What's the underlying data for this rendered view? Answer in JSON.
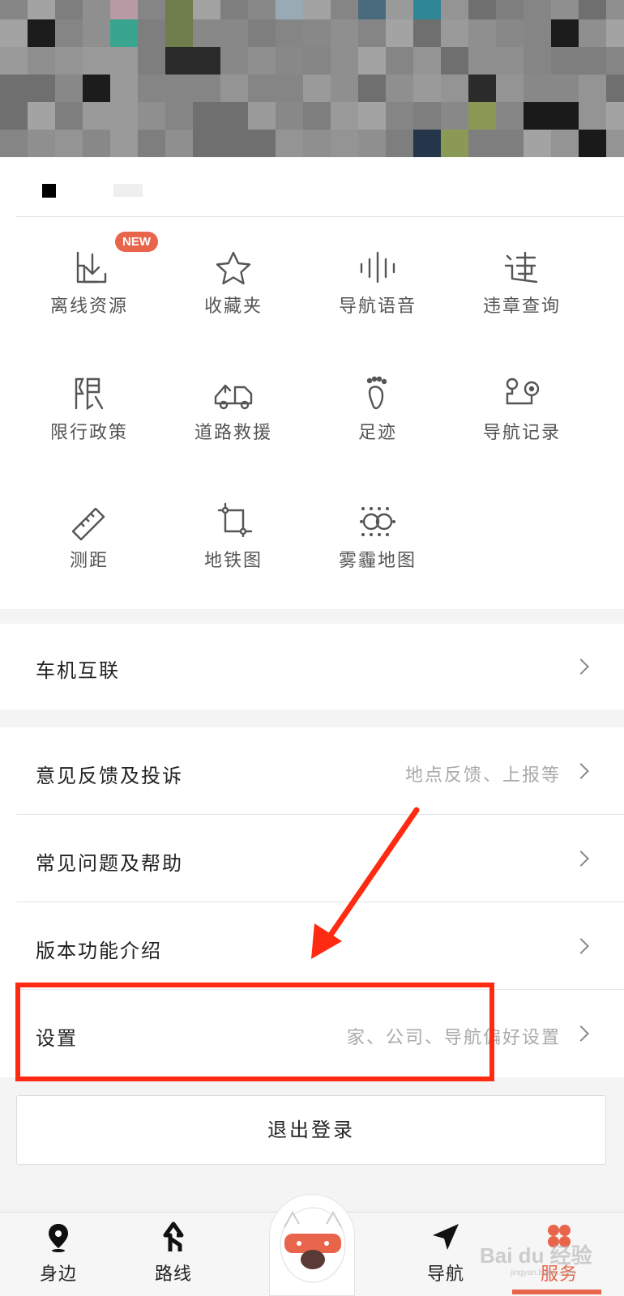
{
  "grid": {
    "badge": "NEW",
    "items": [
      {
        "label": "离线资源",
        "icon": "offline-download-icon"
      },
      {
        "label": "收藏夹",
        "icon": "star-icon"
      },
      {
        "label": "导航语音",
        "icon": "voice-wave-icon"
      },
      {
        "label": "违章查询",
        "icon": "violation-icon"
      },
      {
        "label": "限行政策",
        "icon": "restriction-icon"
      },
      {
        "label": "道路救援",
        "icon": "tow-truck-icon"
      },
      {
        "label": "足迹",
        "icon": "footprint-icon"
      },
      {
        "label": "导航记录",
        "icon": "route-record-icon"
      },
      {
        "label": "测距",
        "icon": "ruler-icon"
      },
      {
        "label": "地铁图",
        "icon": "subway-map-icon"
      },
      {
        "label": "雾霾地图",
        "icon": "haze-map-icon"
      }
    ]
  },
  "menu": {
    "car_link": {
      "title": "车机互联"
    },
    "feedback": {
      "title": "意见反馈及投诉",
      "hint": "地点反馈、上报等"
    },
    "faq": {
      "title": "常见问题及帮助"
    },
    "version": {
      "title": "版本功能介绍"
    },
    "settings": {
      "title": "设置",
      "hint": "家、公司、导航偏好设置"
    }
  },
  "logout_label": "退出登录",
  "tabbar": {
    "items": [
      {
        "label": "身边",
        "icon": "location-pin-icon"
      },
      {
        "label": "路线",
        "icon": "route-fork-icon"
      },
      {
        "label": "导航",
        "icon": "navigation-arrow-icon"
      },
      {
        "label": "服务",
        "icon": "clover-icon"
      }
    ],
    "active": "服务"
  },
  "watermark": {
    "main": "Bai du 经验",
    "sub": "jingyan.baidu.com"
  },
  "colors": {
    "accent": "#e8644a",
    "annotation": "#ff2a12"
  }
}
